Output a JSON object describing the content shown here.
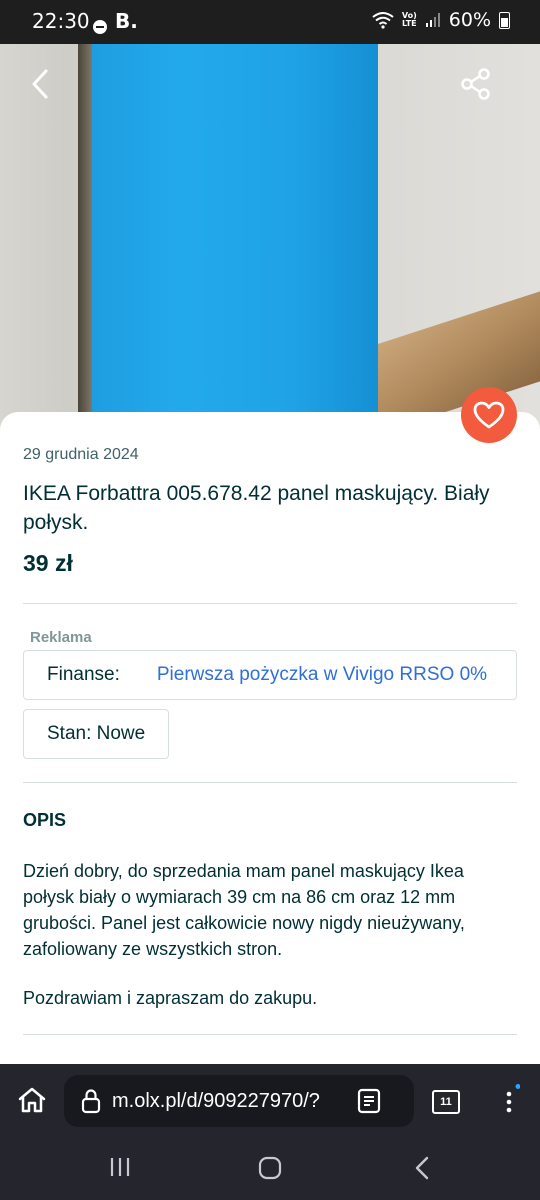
{
  "status_bar": {
    "time": "22:30",
    "carrier_badge": "B.",
    "volte_top": "Vo)",
    "volte_bottom": "LTE",
    "battery": "60%"
  },
  "listing": {
    "date": "29 grudnia 2024",
    "title": "IKEA Forbattra 005.678.42 panel maskujący. Biały połysk.",
    "price": "39 zł",
    "ad_label": "Reklama",
    "ad_key": "Finanse:",
    "ad_link": "Pierwsza pożyczka w Vivigo RRSO 0%",
    "condition": "Stan: Nowe",
    "description_heading": "OPIS",
    "description": "Dzień dobry, do sprzedania mam panel maskujący Ikea połysk biały o wymiarach 39 cm na 86 cm oraz 12 mm grubości. Panel jest całkowicie nowy nigdy nieużywany, zafoliowany ze wszystkich stron.",
    "description_closing": "Pozdrawiam i zapraszam do zakupu."
  },
  "browser": {
    "url": "m.olx.pl/d/909227970/?",
    "tab_count": "11"
  },
  "colors": {
    "accent": "#f25b3d",
    "link": "#2f6fd6",
    "text": "#002f34",
    "browser_bg": "#25252e"
  },
  "icons": [
    "back-arrow-icon",
    "share-icon",
    "heart-icon",
    "home-icon",
    "lock-icon",
    "reader-mode-icon",
    "tabs-icon",
    "more-menu-icon",
    "recent-apps-icon",
    "home-nav-icon",
    "back-nav-icon"
  ]
}
